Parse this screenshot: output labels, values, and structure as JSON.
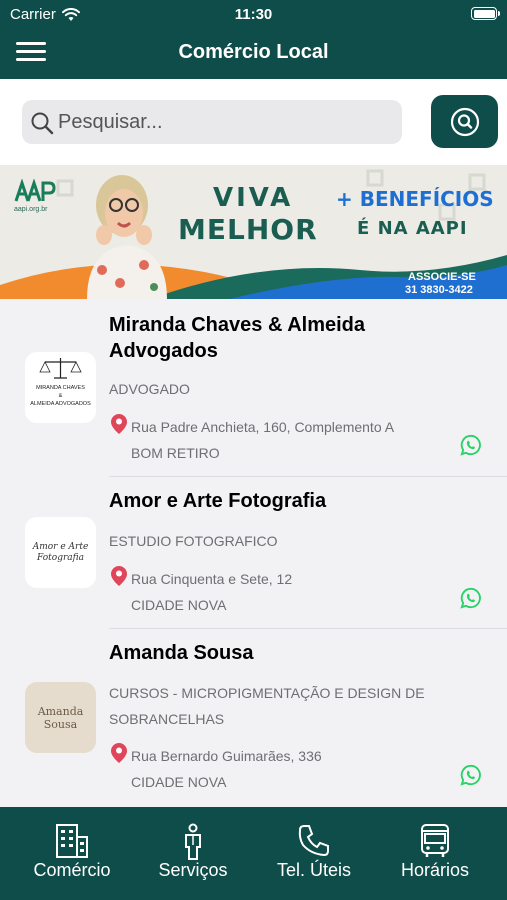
{
  "status_bar": {
    "carrier": "Carrier",
    "time": "11:30"
  },
  "header": {
    "title": "Comércio Local"
  },
  "search": {
    "placeholder": "Pesquisar..."
  },
  "banner": {
    "logo_url": "aapi.org.br",
    "line1": "VIVA",
    "line2": "MELHOR",
    "benefits": "+ BENEFÍCIOS",
    "tagline": "É NA AAPI",
    "cta": "ASSOCIE-SE",
    "phone": "31 3830-3422",
    "colors": {
      "green": "#1a5e52",
      "blue": "#1f6fd1",
      "orange": "#f28a2e"
    }
  },
  "listings": [
    {
      "name": "Miranda Chaves & Almeida Advogados",
      "category": "ADVOGADO",
      "address": "Rua Padre Anchieta, 160, Complemento A",
      "neighborhood": "BOM RETIRO",
      "logo_text_1": "MIRANDA CHAVES",
      "logo_text_2": "&",
      "logo_text_3": "ALMEIDA ADVOGADOS"
    },
    {
      "name": "Amor e Arte Fotografia",
      "category": "ESTUDIO FOTOGRAFICO",
      "address": "Rua Cinquenta e Sete, 12",
      "neighborhood": "CIDADE NOVA",
      "logo_text_1": "Amor e Arte",
      "logo_text_2": "Fotografia"
    },
    {
      "name": "Amanda Sousa",
      "category": "CURSOS - MICROPIGMENTAÇÃO E DESIGN DE SOBRANCELHAS",
      "address": "Rua Bernardo Guimarães, 336",
      "neighborhood": "CIDADE NOVA",
      "logo_text_1": "Amanda",
      "logo_text_2": "Sousa"
    }
  ],
  "tabs": [
    {
      "label": "Comércio",
      "icon": "building-icon"
    },
    {
      "label": "Serviços",
      "icon": "person-icon"
    },
    {
      "label": "Tel. Úteis",
      "icon": "phone-icon"
    },
    {
      "label": "Horários",
      "icon": "bus-icon"
    }
  ],
  "colors": {
    "primary": "#0e4d49",
    "whatsapp": "#25d366",
    "pin": "#e0455a"
  }
}
